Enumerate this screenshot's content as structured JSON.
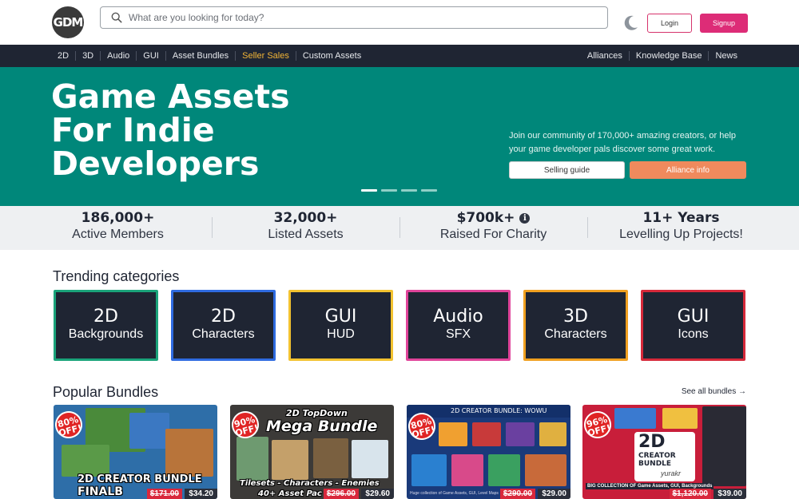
{
  "header": {
    "logo_text": "GDM",
    "search_placeholder": "What are you looking for today?",
    "login_label": "Login",
    "signup_label": "Signup",
    "accent_color": "#dd2c77"
  },
  "nav": {
    "left": [
      {
        "label": "2D"
      },
      {
        "label": "3D"
      },
      {
        "label": "Audio"
      },
      {
        "label": "GUI"
      },
      {
        "label": "Asset Bundles"
      },
      {
        "label": "Seller Sales"
      },
      {
        "label": "Custom Assets"
      }
    ],
    "right": [
      {
        "label": "Alliances"
      },
      {
        "label": "Knowledge Base"
      },
      {
        "label": "News"
      }
    ]
  },
  "hero": {
    "title_lines": [
      "Game Assets",
      "For Indie",
      "Developers"
    ],
    "text": "Join our community of 170,000+ amazing creators, or help your game developer pals discover some great work.",
    "selling_guide_label": "Selling guide",
    "alliance_info_label": "Alliance info",
    "background_color": "#00877a"
  },
  "stats": [
    {
      "value": "186,000+",
      "label": "Active Members"
    },
    {
      "value": "32,000+",
      "label": "Listed Assets"
    },
    {
      "value": "$700k+",
      "label": "Raised For Charity"
    },
    {
      "value": "11+ Years",
      "label": "Levelling Up Projects!"
    }
  ],
  "trending": {
    "title": "Trending categories",
    "items": [
      {
        "main": "2D",
        "sub": "Backgrounds",
        "border": "#1aa37a"
      },
      {
        "main": "2D",
        "sub": "Characters",
        "border": "#2f6be0"
      },
      {
        "main": "GUI",
        "sub": "HUD",
        "border": "#f2c230"
      },
      {
        "main": "Audio",
        "sub": "SFX",
        "border": "#e0449a"
      },
      {
        "main": "3D",
        "sub": "Characters",
        "border": "#f0a020"
      },
      {
        "main": "GUI",
        "sub": "Icons",
        "border": "#d6293a"
      }
    ]
  },
  "bundles": {
    "title": "Popular Bundles",
    "see_all": "See all bundles →",
    "items": [
      {
        "badge": "80% OFF!",
        "title": "2D CREATOR BUNDLE",
        "title2": "FINALB",
        "old_price": "$171.00",
        "new_price": "$34.20"
      },
      {
        "badge": "90% OFF!",
        "title": "2D TopDown",
        "title2": "Mega Bundle",
        "caption": "Tilesets - Characters - Enemies",
        "caption2": "40+ Asset Pac",
        "old_price": "$296.00",
        "new_price": "$29.60"
      },
      {
        "badge": "80% OFF!",
        "title": "2D CREATOR BUNDLE: WOWU",
        "caption": "Huge collection of Game Assets, GUI, Level Maps",
        "old_price": "$290.00",
        "new_price": "$29.00"
      },
      {
        "badge": "96% OFF!",
        "title": "2D",
        "title2": "CREATOR",
        "title3": "BUNDLE",
        "author": "yurakr",
        "caption": "BIG COLLECTION OF Game Assets, GUI, Backgrounds",
        "old_price": "$1,120.00",
        "new_price": "$39.00"
      }
    ]
  }
}
